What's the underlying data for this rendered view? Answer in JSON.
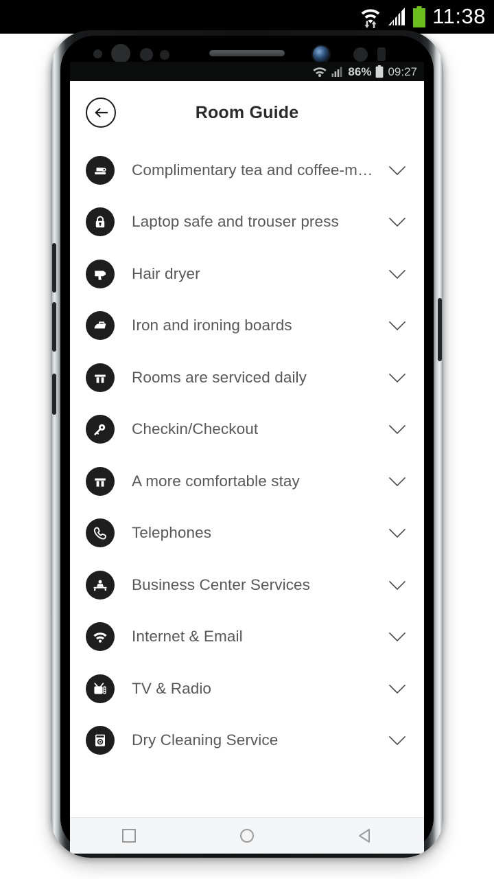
{
  "host_status_bar": {
    "time": "11:38",
    "icons": [
      "wifi-transfer-icon",
      "cellular-signal-icon",
      "battery-full-icon"
    ],
    "background": "#000000",
    "battery_color": "#6abf1f"
  },
  "phone_status_bar": {
    "time": "09:27",
    "battery_percent": "86%",
    "icons": [
      "wifi-icon",
      "cellular-signal-icon",
      "battery-icon"
    ],
    "background": "#0b0c0c"
  },
  "header": {
    "title": "Room Guide",
    "back_icon": "arrow-left-circle-icon"
  },
  "list": {
    "expand_icon": "chevron-down-icon",
    "items": [
      {
        "label": "Complimentary tea and coffee-making fa...",
        "icon": "coffee-maker-icon"
      },
      {
        "label": "Laptop safe and trouser press",
        "icon": "safe-lock-icon"
      },
      {
        "label": "Hair dryer",
        "icon": "hair-dryer-icon"
      },
      {
        "label": "Iron and ironing boards",
        "icon": "iron-icon"
      },
      {
        "label": "Rooms are serviced daily",
        "icon": "towel-stack-icon"
      },
      {
        "label": "Checkin/Checkout",
        "icon": "key-icon"
      },
      {
        "label": "A more comfortable stay",
        "icon": "towel-stack-icon"
      },
      {
        "label": "Telephones",
        "icon": "telephone-icon"
      },
      {
        "label": "Business Center Services",
        "icon": "business-desk-icon"
      },
      {
        "label": "Internet & Email",
        "icon": "wifi-icon"
      },
      {
        "label": "TV & Radio",
        "icon": "television-icon"
      },
      {
        "label": "Dry Cleaning Service",
        "icon": "washing-machine-icon"
      },
      {
        "label": "",
        "icon": "partial-next-icon"
      }
    ]
  },
  "nav_bar": {
    "buttons": [
      {
        "name": "recents-button",
        "icon": "square-icon"
      },
      {
        "name": "home-button",
        "icon": "circle-icon"
      },
      {
        "name": "back-button",
        "icon": "triangle-left-icon"
      }
    ],
    "background": "#f4f5f6",
    "icon_color": "#9b9b9b"
  },
  "theme": {
    "page_background": "#ffffff",
    "icon_badge_color": "#1e1e1e",
    "label_color": "#585858",
    "title_color": "#2b2b2b"
  }
}
